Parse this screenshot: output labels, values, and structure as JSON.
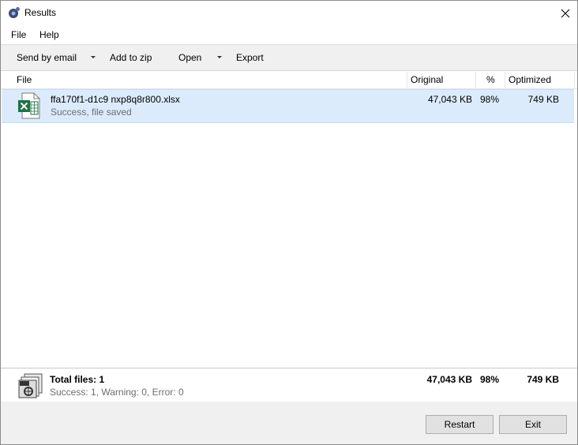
{
  "window": {
    "title": "Results"
  },
  "menu": [
    {
      "label": "File"
    },
    {
      "label": "Help"
    }
  ],
  "toolbar": {
    "send_by_email": "Send by email",
    "add_to_zip": "Add to zip",
    "open": "Open",
    "export": "Export"
  },
  "columns": {
    "file": "File",
    "original": "Original",
    "percent": "%",
    "optimized": "Optimized"
  },
  "rows": [
    {
      "name": "ffa170f1-d1c9 nxp8q8r800.xlsx",
      "status": "Success, file saved",
      "original": "47,043 KB",
      "percent": "98%",
      "optimized": "749 KB",
      "icon": "excel-file-icon"
    }
  ],
  "summary": {
    "title": "Total files: 1",
    "detail": "Success: 1, Warning: 0, Error: 0",
    "original": "47,043 KB",
    "percent": "98%",
    "optimized": "749 KB"
  },
  "buttons": {
    "restart": "Restart",
    "exit": "Exit"
  },
  "colors": {
    "selected_row": "#dcebfc",
    "excel_green": "#1e7145"
  }
}
